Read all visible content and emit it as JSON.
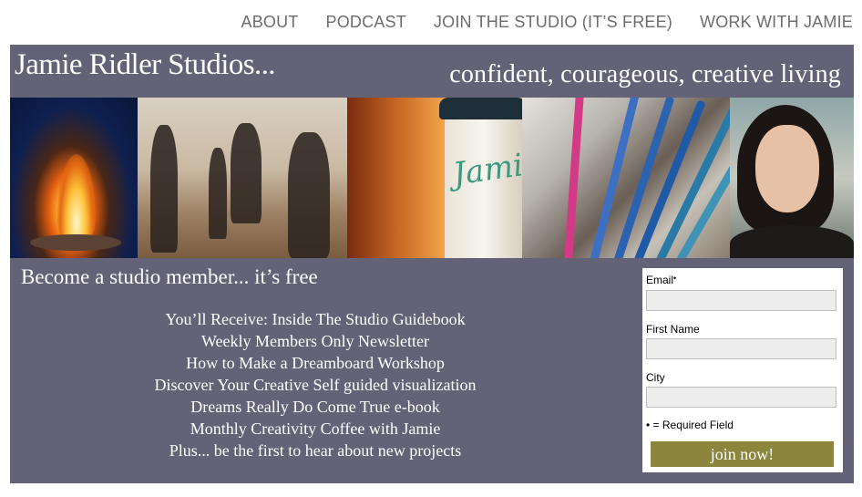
{
  "nav": {
    "items": [
      {
        "label": "ABOUT"
      },
      {
        "label": "PODCAST"
      },
      {
        "label": "JOIN THE STUDIO (IT’S FREE)"
      },
      {
        "label": "WORK WITH JAMIE"
      }
    ]
  },
  "header": {
    "site_title": "Jamie Ridler Studios...",
    "tagline": "confident, courageous, creative living"
  },
  "photos": {
    "cup_text": "Jamie"
  },
  "signup": {
    "heading": "Become a studio member... it’s free",
    "benefits": [
      "You’ll Receive: Inside The Studio Guidebook",
      "Weekly Members Only Newsletter",
      "How to Make a Dreamboard Workshop",
      "Discover Your Creative Self guided visualization",
      "Dreams Really Do Come True e-book",
      "Monthly Creativity Coffee with Jamie",
      "Plus... be the first to hear about new projects"
    ]
  },
  "form": {
    "email_label": "Email",
    "email_required_mark": "•",
    "email_value": "",
    "first_name_label": "First Name",
    "first_name_value": "",
    "city_label": "City",
    "city_value": "",
    "required_note": "• = Required Field",
    "submit_label": "join now!"
  },
  "colors": {
    "panel": "#646277",
    "button": "#8c853d",
    "nav_text": "#6c6c6c"
  }
}
